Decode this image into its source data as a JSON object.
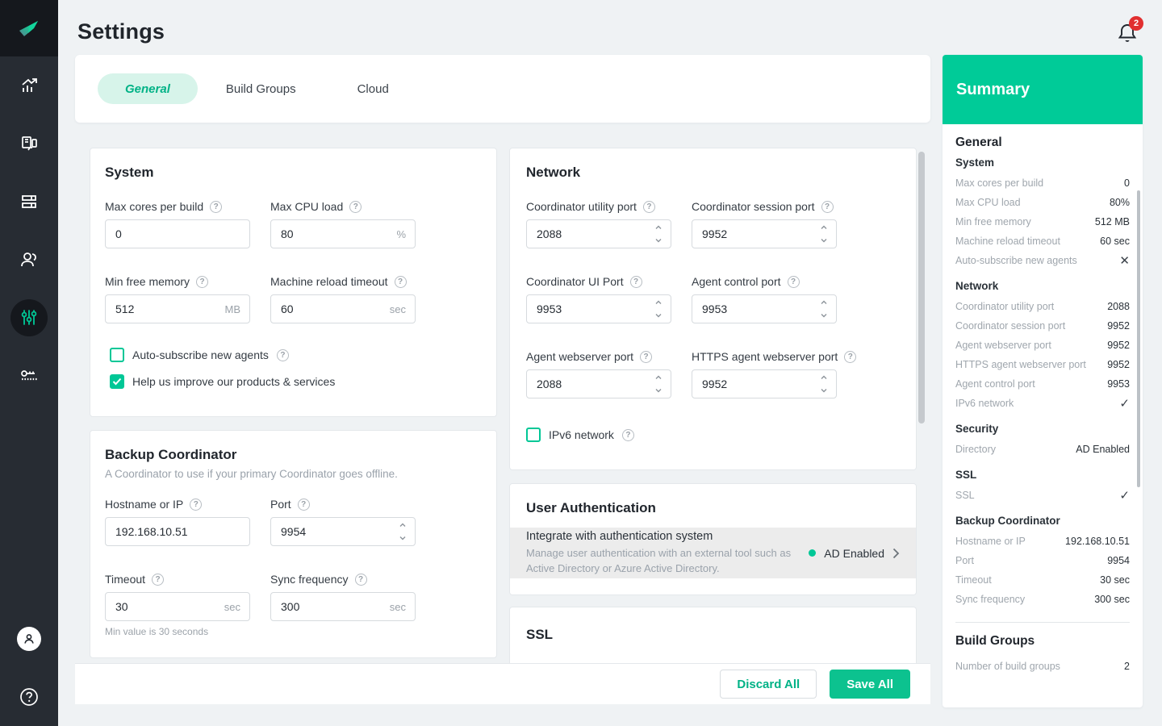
{
  "colors": {
    "accent": "#00c796",
    "accent_light": "#d7f4ea",
    "summary_header": "#00cb98",
    "save_button": "#0cc28f",
    "sidebar_bg": "#272c33",
    "sidebar_logo_bg": "#15181d",
    "badge_red": "#e12f2f",
    "page_bg": "#eff2f4",
    "auth_row_bg": "#ececec"
  },
  "sidebar": {
    "items": [
      {
        "name": "dashboard",
        "icon": "chart-arrow-icon",
        "active": false
      },
      {
        "name": "agents",
        "icon": "devices-icon",
        "active": false
      },
      {
        "name": "builds",
        "icon": "layout-icon",
        "active": false
      },
      {
        "name": "users",
        "icon": "users-icon",
        "active": false
      },
      {
        "name": "settings",
        "icon": "sliders-icon",
        "active": true
      },
      {
        "name": "license",
        "icon": "key-icon",
        "active": false
      }
    ],
    "bottom": [
      {
        "name": "account",
        "icon": "avatar-icon"
      },
      {
        "name": "help",
        "icon": "question-icon"
      }
    ]
  },
  "header": {
    "title": "Settings",
    "notification_count": "2"
  },
  "tabs": [
    {
      "label": "General",
      "active": true
    },
    {
      "label": "Build Groups",
      "active": false
    },
    {
      "label": "Cloud",
      "active": false
    }
  ],
  "system": {
    "title": "System",
    "fields": [
      {
        "label": "Max cores per build",
        "value": "0",
        "suffix": ""
      },
      {
        "label": "Max CPU load",
        "value": "80",
        "suffix": "%"
      },
      {
        "label": "Min free memory",
        "value": "512",
        "suffix": "MB"
      },
      {
        "label": "Machine reload timeout",
        "value": "60",
        "suffix": "sec"
      }
    ],
    "checkboxes": [
      {
        "label": "Auto-subscribe new agents",
        "checked": false
      },
      {
        "label": "Help us improve our products & services",
        "checked": true
      }
    ]
  },
  "backup": {
    "title": "Backup Coordinator",
    "subtitle": "A Coordinator to use if your primary Coordinator goes offline.",
    "fields": [
      {
        "label": "Hostname or IP",
        "value": "192.168.10.51"
      },
      {
        "label": "Port",
        "value": "9954"
      },
      {
        "label": "Timeout",
        "value": "30",
        "suffix": "sec"
      },
      {
        "label": "Sync frequency",
        "value": "300",
        "suffix": "sec"
      }
    ],
    "helper": "Min value is 30 seconds"
  },
  "network": {
    "title": "Network",
    "fields": [
      {
        "label": "Coordinator utility port",
        "value": "2088"
      },
      {
        "label": "Coordinator session port",
        "value": "9952"
      },
      {
        "label": "Coordinator UI Port",
        "value": "9953"
      },
      {
        "label": "Agent control port",
        "value": "9953"
      },
      {
        "label": "Agent webserver port",
        "value": "2088"
      },
      {
        "label": "HTTPS agent webserver port",
        "value": "9952"
      }
    ],
    "checkbox": {
      "label": "IPv6 network",
      "checked": false
    }
  },
  "auth": {
    "title": "User Authentication",
    "row_title": "Integrate with authentication system",
    "row_desc": "Manage user authentication with an external tool such as Active Directory or Azure Active Directory.",
    "status": "AD Enabled"
  },
  "ssl": {
    "title": "SSL"
  },
  "footer": {
    "discard_label": "Discard All",
    "save_label": "Save All"
  },
  "summary": {
    "title": "Summary",
    "general_heading": "General",
    "groups": [
      {
        "title": "System",
        "rows": [
          {
            "label": "Max cores per build",
            "value": "0"
          },
          {
            "label": "Max CPU load",
            "value": "80%"
          },
          {
            "label": "Min free memory",
            "value": "512 MB"
          },
          {
            "label": "Machine reload timeout",
            "value": "60 sec"
          },
          {
            "label": "Auto-subscribe new agents",
            "value": "✕"
          }
        ]
      },
      {
        "title": "Network",
        "rows": [
          {
            "label": "Coordinator utility port",
            "value": "2088"
          },
          {
            "label": "Coordinator session port",
            "value": "9952"
          },
          {
            "label": "Agent webserver port",
            "value": "9952"
          },
          {
            "label": "HTTPS agent webserver port",
            "value": "9952"
          },
          {
            "label": "Agent control port",
            "value": "9953"
          },
          {
            "label": "IPv6 network",
            "value": "✓"
          }
        ]
      },
      {
        "title": "Security",
        "rows": [
          {
            "label": "Directory",
            "value": "AD Enabled"
          }
        ]
      },
      {
        "title": "SSL",
        "rows": [
          {
            "label": "SSL",
            "value": "✓"
          }
        ]
      },
      {
        "title": "Backup Coordinator",
        "rows": [
          {
            "label": "Hostname or IP",
            "value": "192.168.10.51"
          },
          {
            "label": "Port",
            "value": "9954"
          },
          {
            "label": "Timeout",
            "value": "30 sec"
          },
          {
            "label": "Sync frequency",
            "value": "300 sec"
          }
        ]
      }
    ],
    "build_groups_heading": "Build Groups",
    "build_groups_row": {
      "label": "Number of build groups",
      "value": "2"
    }
  }
}
